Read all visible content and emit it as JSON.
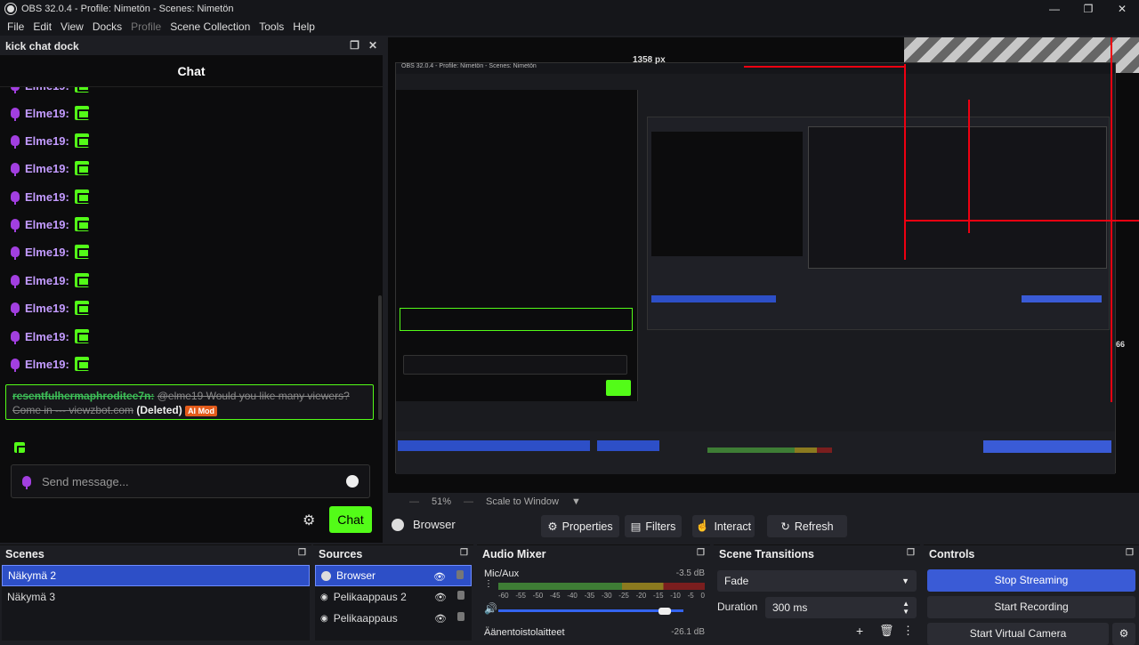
{
  "window": {
    "title": "OBS 32.0.4 - Profile: Nimetön - Scenes: Nimetön",
    "buttons": [
      "—",
      "❐",
      "✕"
    ]
  },
  "menu": [
    "File",
    "Edit",
    "View",
    "Docks",
    "Profile",
    "Scene Collection",
    "Tools",
    "Help"
  ],
  "chat_dock": {
    "title": "kick chat dock",
    "chat_header": "Chat",
    "message_user": "Elme19:",
    "pinned": {
      "user": "resentfulhermaphroditee7n:",
      "text": "@elme19 Would you like many viewers? Come in --- viewzbot.com",
      "deleted": "(Deleted)",
      "badge": "AI Mod"
    },
    "send_placeholder": "Send message...",
    "chat_button": "Chat"
  },
  "preview": {
    "width_label": "1358 px",
    "side_label": "66"
  },
  "zoom": {
    "percent": "51%",
    "mode": "Scale to Window"
  },
  "source_toolbar": {
    "name": "Browser",
    "buttons": [
      "Properties",
      "Filters",
      "Interact",
      "Refresh"
    ]
  },
  "scenes": {
    "title": "Scenes",
    "items": [
      "Näkymä 2",
      "Näkymä 3"
    ]
  },
  "sources": {
    "title": "Sources",
    "items": [
      "Browser",
      "Pelikaappaus 2",
      "Pelikaappaus"
    ]
  },
  "mixer": {
    "title": "Audio Mixer",
    "ch1": {
      "name": "Mic/Aux",
      "db": "-3.5 dB"
    },
    "ch2": {
      "name": "Äänentoistolaitteet",
      "db": "-26.1 dB"
    },
    "ticks": [
      "-60",
      "-55",
      "-50",
      "-45",
      "-40",
      "-35",
      "-30",
      "-25",
      "-20",
      "-15",
      "-10",
      "-5",
      "0"
    ]
  },
  "transitions": {
    "title": "Scene Transitions",
    "type": "Fade",
    "duration_label": "Duration",
    "duration": "300 ms"
  },
  "controls": {
    "title": "Controls",
    "stream": "Stop Streaming",
    "record": "Start Recording",
    "vcam": "Start Virtual Camera"
  },
  "colors": {
    "kick_green": "#53fc18",
    "obs_blue": "#3a5bd6",
    "red_guide": "#ee0011"
  }
}
